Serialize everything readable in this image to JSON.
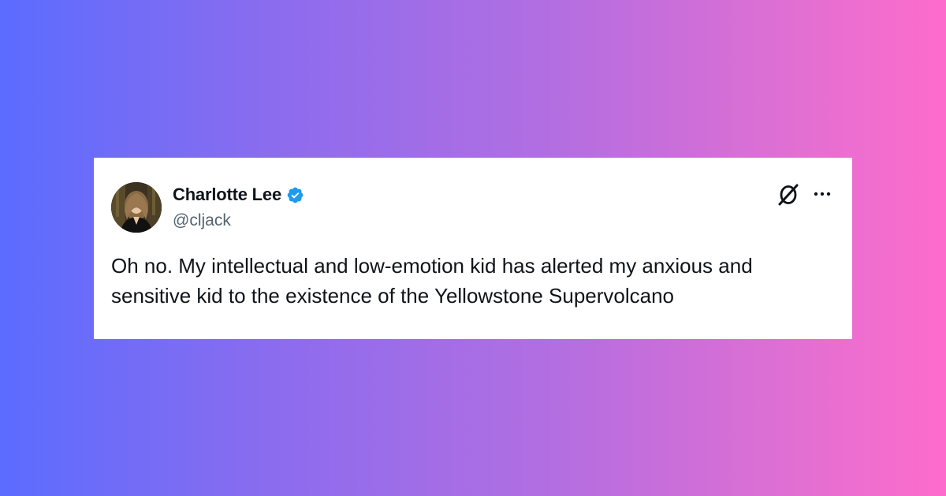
{
  "tweet": {
    "display_name": "Charlotte Lee",
    "handle": "@cljack",
    "text": "Oh no. My intellectual and low-emotion kid has alerted my anxious and sensitive kid to the existence of the Yellowstone Supervolcano",
    "verified": true,
    "icons": {
      "verified": "verified-badge-icon",
      "logo": "x-logo-icon",
      "more": "more-options-icon"
    }
  },
  "colors": {
    "gradient_start": "#5b6cff",
    "gradient_end": "#fe6ccb",
    "card_bg": "#ffffff",
    "text": "#0f1419",
    "handle": "#536471",
    "verified": "#1d9bf0"
  }
}
